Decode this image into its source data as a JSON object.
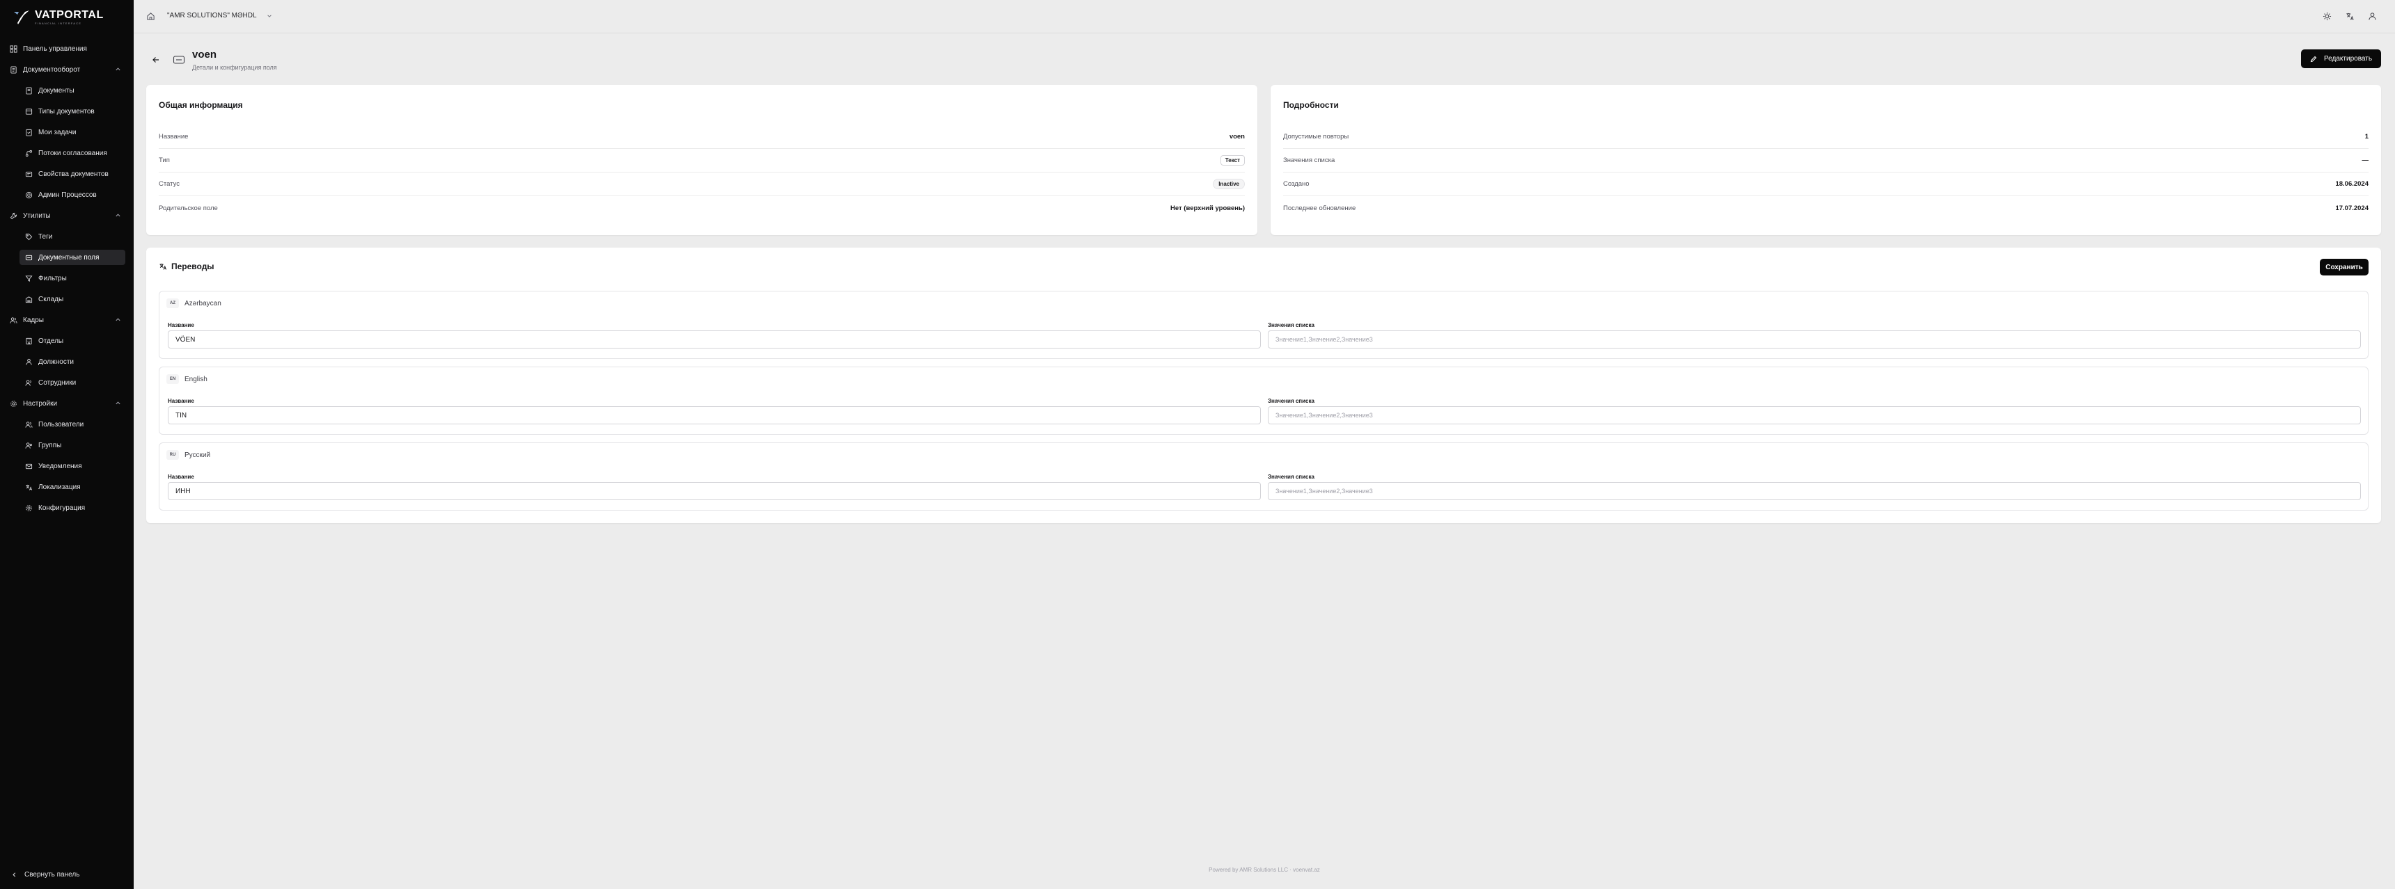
{
  "brand": {
    "name": "VATPORTAL",
    "tagline": "FINANCIAL INTERFACE"
  },
  "sidebar": {
    "sections": [
      {
        "label": "Панель управления",
        "icon": "dashboard-icon",
        "items": []
      },
      {
        "label": "Документооборот",
        "icon": "document-flow-icon",
        "expanded": true,
        "items": [
          {
            "label": "Документы",
            "icon": "document-icon"
          },
          {
            "label": "Типы документов",
            "icon": "document-types-icon"
          },
          {
            "label": "Мои задачи",
            "icon": "tasks-icon"
          },
          {
            "label": "Потоки согласования",
            "icon": "workflow-icon"
          },
          {
            "label": "Свойства документов",
            "icon": "properties-icon"
          },
          {
            "label": "Админ Процессов",
            "icon": "process-admin-icon"
          }
        ]
      },
      {
        "label": "Утилиты",
        "icon": "wrench-icon",
        "expanded": true,
        "items": [
          {
            "label": "Теги",
            "icon": "tag-icon"
          },
          {
            "label": "Документные поля",
            "icon": "field-icon",
            "active": true
          },
          {
            "label": "Фильтры",
            "icon": "filter-icon"
          },
          {
            "label": "Склады",
            "icon": "warehouse-icon"
          }
        ]
      },
      {
        "label": "Кадры",
        "icon": "people-icon",
        "expanded": true,
        "items": [
          {
            "label": "Отделы",
            "icon": "building-icon"
          },
          {
            "label": "Должности",
            "icon": "position-icon"
          },
          {
            "label": "Сотрудники",
            "icon": "employees-icon"
          }
        ]
      },
      {
        "label": "Настройки",
        "icon": "gear-icon",
        "expanded": true,
        "items": [
          {
            "label": "Пользователи",
            "icon": "users-icon"
          },
          {
            "label": "Группы",
            "icon": "groups-icon"
          },
          {
            "label": "Уведомления",
            "icon": "notification-icon"
          },
          {
            "label": "Локализация",
            "icon": "language-icon"
          },
          {
            "label": "Конфигурация",
            "icon": "config-icon"
          }
        ]
      }
    ],
    "collapse_label": "Свернуть панель"
  },
  "topbar": {
    "company": "\"AMR SOLUTIONS\" MƏHDL"
  },
  "header": {
    "title": "voen",
    "subtitle": "Детали и конфигурация поля",
    "edit_label": "Редактировать"
  },
  "general": {
    "title": "Общая информация",
    "rows": [
      {
        "key": "Название",
        "value": "voen"
      },
      {
        "key": "Тип",
        "value": "Текст"
      },
      {
        "key": "Статус",
        "value": "Inactive"
      },
      {
        "key": "Родительское поле",
        "value": "Нет (верхний уровень)"
      }
    ]
  },
  "details": {
    "title": "Подробности",
    "rows": [
      {
        "key": "Допустимые повторы",
        "value": "1"
      },
      {
        "key": "Значения списка",
        "value": "—"
      },
      {
        "key": "Создано",
        "value": "18.06.2024"
      },
      {
        "key": "Последнее обновление",
        "value": "17.07.2024"
      }
    ]
  },
  "translations": {
    "title": "Переводы",
    "save_label": "Сохранить",
    "name_label": "Название",
    "list_label": "Значения списка",
    "list_placeholder": "Значение1,Значение2,Значение3",
    "languages": [
      {
        "code": "AZ",
        "name": "Azərbaycan",
        "value": "VÖEN"
      },
      {
        "code": "EN",
        "name": "English",
        "value": "TIN"
      },
      {
        "code": "RU",
        "name": "Русский",
        "value": "ИНН"
      }
    ]
  },
  "footer": {
    "text": "Powered by AMR Solutions LLC · voenvat.az"
  }
}
